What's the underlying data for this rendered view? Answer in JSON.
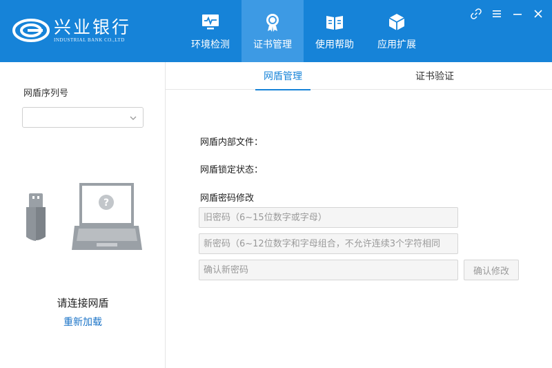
{
  "brand": {
    "name_cn": "兴业银行",
    "name_en": "INDUSTRIAL BANK CO.,LTD"
  },
  "nav": {
    "items": [
      {
        "label": "环境检测",
        "icon": "monitor-icon"
      },
      {
        "label": "证书管理",
        "icon": "certificate-icon",
        "active": true
      },
      {
        "label": "使用帮助",
        "icon": "book-icon"
      },
      {
        "label": "应用扩展",
        "icon": "cube-icon"
      }
    ]
  },
  "window_controls": [
    "link-icon",
    "menu-icon",
    "minimize-icon",
    "close-icon"
  ],
  "left": {
    "serial_label": "网盾序列号",
    "serial_value": "",
    "connect_text": "请连接网盾",
    "reload_label": "重新加载"
  },
  "tabs": [
    {
      "label": "网盾管理",
      "active": true
    },
    {
      "label": "证书验证",
      "active": false
    }
  ],
  "form": {
    "internal_file_label": "网盾内部文件：",
    "lock_status_label": "网盾锁定状态：",
    "password_section_label": "网盾密码修改",
    "old_password_placeholder": "旧密码（6~15位数字或字母）",
    "new_password_placeholder": "新密码（6~12位数字和字母组合，不允许连续3个字符相同",
    "confirm_password_placeholder": "确认新密码",
    "confirm_button_label": "确认修改"
  },
  "colors": {
    "header": "#1683d8",
    "nav_active": "#3d9ae4",
    "link": "#1a73c7"
  }
}
